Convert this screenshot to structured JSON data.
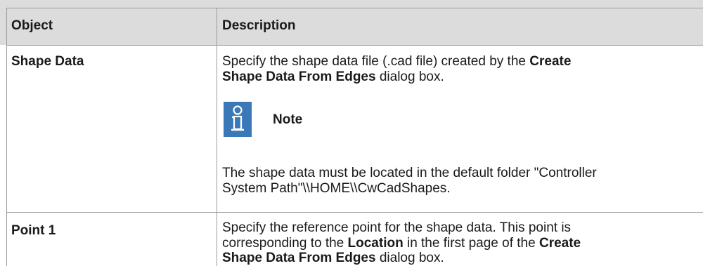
{
  "table": {
    "headers": {
      "object": "Object",
      "description": "Description"
    },
    "rows": [
      {
        "object": "Shape Data",
        "description": {
          "line1_a": "Specify the shape data file (.cad file) created by the ",
          "line1_b": "Create",
          "line2_a": "Shape Data From Edges",
          "line2_b": " dialog box.",
          "note_icon": "info-person-icon",
          "note_label": "Note",
          "note_line1": "The shape data must be located in the default folder \"Controller",
          "note_line2": "System Path\"\\\\HOME\\\\CwCadShapes."
        }
      },
      {
        "object": "Point 1",
        "description": {
          "line1": "Specify the reference point for the shape data. This point is",
          "line2_a": "corresponding to the ",
          "line2_b": "Location",
          "line2_c": " in the first page of the ",
          "line2_d": "Create",
          "line3_a": "Shape Data From Edges",
          "line3_b": " dialog box."
        }
      }
    ]
  },
  "colors": {
    "header_bg": "#dcdcdc",
    "border": "#9a9a9a",
    "note_icon_bg": "#3a78b7",
    "text": "#1a1a1a"
  }
}
